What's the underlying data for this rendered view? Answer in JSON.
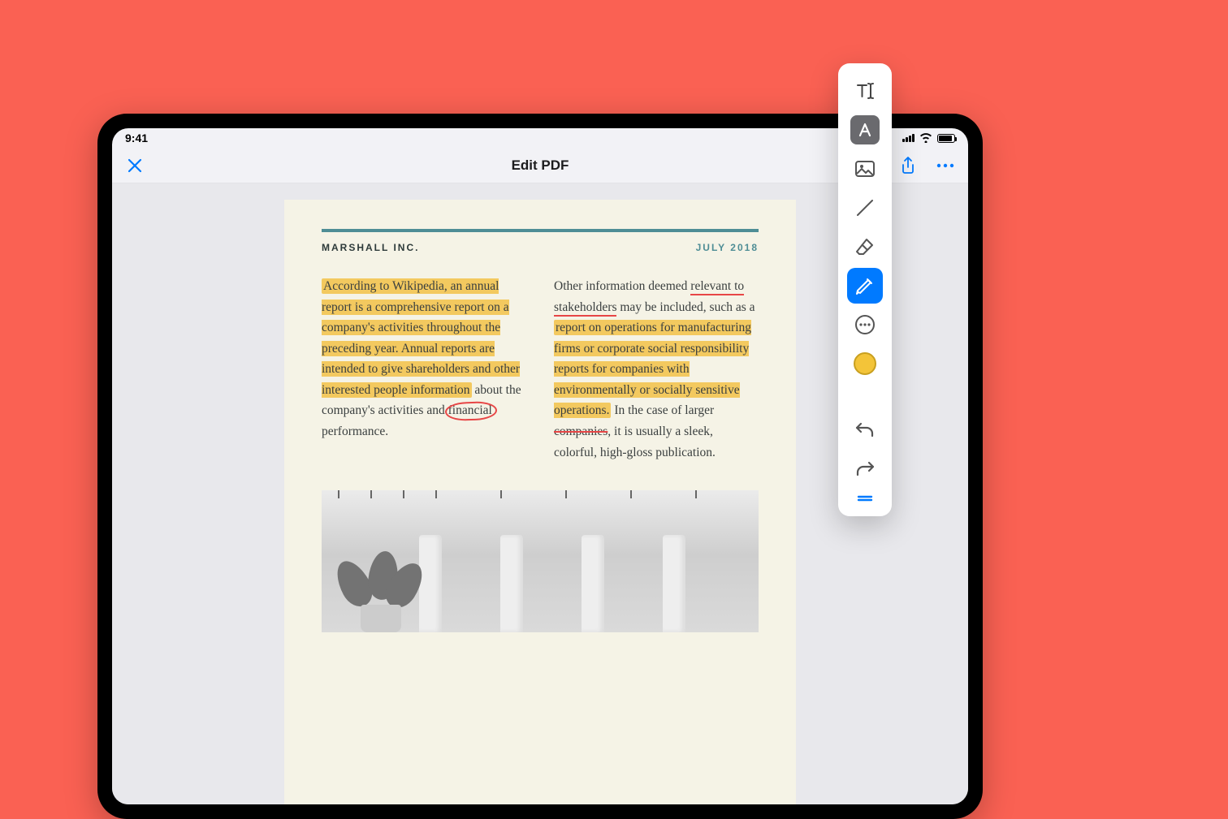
{
  "status": {
    "time": "9:41"
  },
  "nav": {
    "title": "Edit PDF"
  },
  "doc": {
    "company": "MARSHALL INC.",
    "date": "JULY 2018",
    "col1": {
      "hl1": "According to Wikipedia, an annual report is a comprehensive report on a company's activities throughout the preceding year. Annual reports are intended to give shareholders and other interested people information",
      "plain1": " about the company's activities and ",
      "circled": "financial",
      "plain2": " performance."
    },
    "col2": {
      "plain1": "Other information deemed ",
      "under": "relevant to stakeholders",
      "plain2": " may be included, such as a ",
      "hl1": "report on operations for manufacturing firms or corporate social responsibility reports for companies with environmentally or socially sensitive operations.",
      "plain3": " In the case of larger ",
      "strike": "companies",
      "plain4": ", it is usually a sleek, colorful, high-gloss publication."
    }
  },
  "tools": {
    "text": "text-tool",
    "textbox": "text-box-tool",
    "image": "image-tool",
    "line": "line-tool",
    "eraser": "eraser-tool",
    "annotate": "annotate-tool",
    "more": "more-tool",
    "color": "color-picker",
    "undo": "undo",
    "redo": "redo",
    "handle": "drag-handle"
  },
  "colors": {
    "highlight": "#f3c95f",
    "accent": "#007aff"
  }
}
